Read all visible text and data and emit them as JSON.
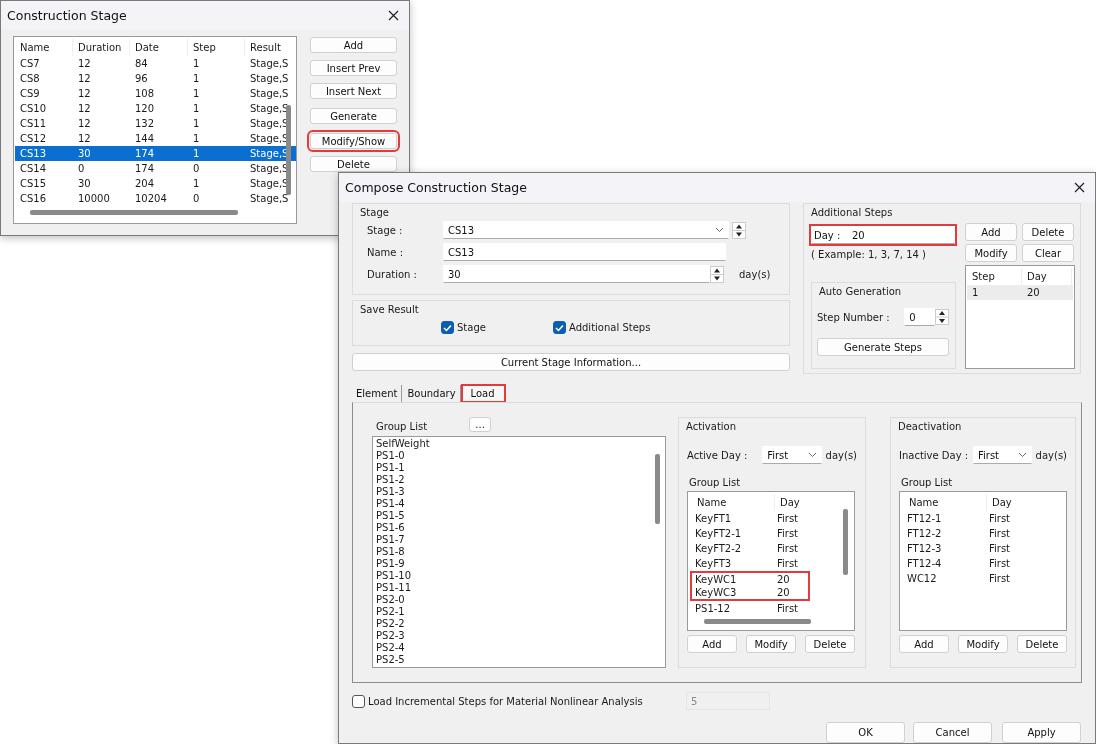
{
  "stage_list_window": {
    "title": "Construction Stage",
    "columns": [
      "Name",
      "Duration",
      "Date",
      "Step",
      "Result"
    ],
    "rows": [
      {
        "cells": [
          "CS7",
          "12",
          "84",
          "1",
          "Stage,S"
        ],
        "selected": false
      },
      {
        "cells": [
          "CS8",
          "12",
          "96",
          "1",
          "Stage,S"
        ],
        "selected": false
      },
      {
        "cells": [
          "CS9",
          "12",
          "108",
          "1",
          "Stage,S"
        ],
        "selected": false
      },
      {
        "cells": [
          "CS10",
          "12",
          "120",
          "1",
          "Stage,S"
        ],
        "selected": false
      },
      {
        "cells": [
          "CS11",
          "12",
          "132",
          "1",
          "Stage,S"
        ],
        "selected": false
      },
      {
        "cells": [
          "CS12",
          "12",
          "144",
          "1",
          "Stage,S"
        ],
        "selected": false
      },
      {
        "cells": [
          "CS13",
          "30",
          "174",
          "1",
          "Stage,S"
        ],
        "selected": true
      },
      {
        "cells": [
          "CS14",
          "0",
          "174",
          "0",
          "Stage,S"
        ],
        "selected": false
      },
      {
        "cells": [
          "CS15",
          "30",
          "204",
          "1",
          "Stage,S"
        ],
        "selected": false
      },
      {
        "cells": [
          "CS16",
          "10000",
          "10204",
          "0",
          "Stage,S"
        ],
        "selected": false
      }
    ],
    "buttons": [
      {
        "label": "Add",
        "highlighted": false
      },
      {
        "label": "Insert Prev",
        "highlighted": false
      },
      {
        "label": "Insert Next",
        "highlighted": false
      },
      {
        "label": "Generate",
        "highlighted": false
      },
      {
        "label": "Modify/Show",
        "highlighted": true
      },
      {
        "label": "Delete",
        "highlighted": false
      }
    ]
  },
  "compose_window": {
    "title": "Compose Construction Stage",
    "stage_group": {
      "title": "Stage",
      "stage_label": "Stage :",
      "stage_value": "CS13",
      "name_label": "Name :",
      "name_value": "CS13",
      "duration_label": "Duration :",
      "duration_value": "30",
      "unit": "day(s)"
    },
    "save_result": {
      "title": "Save Result",
      "options": [
        {
          "label": "Stage",
          "checked": true
        },
        {
          "label": "Additional Steps",
          "checked": true
        }
      ]
    },
    "info_button": "Current Stage Information...",
    "additional_steps": {
      "title": "Additional Steps",
      "day_label": "Day :",
      "day_value": "20",
      "day_highlighted": true,
      "example": "( Example: 1, 3, 7, 14  )",
      "buttons": [
        "Add",
        "Delete",
        "Modify",
        "Clear"
      ],
      "auto_generation": {
        "title": "Auto Generation",
        "step_label": "Step Number  :",
        "step_value": "0",
        "button": "Generate Steps"
      },
      "columns": [
        "Step",
        "Day"
      ],
      "rows": [
        {
          "cells": [
            "1",
            "20"
          ],
          "selected": true
        }
      ]
    },
    "tabs": [
      {
        "label": "Element",
        "selected": false,
        "highlighted": false
      },
      {
        "label": "Boundary",
        "selected": false,
        "highlighted": false
      },
      {
        "label": "Load",
        "selected": true,
        "highlighted": true
      }
    ],
    "group_list": {
      "label": "Group List",
      "browse_button": "...",
      "items": [
        "SelfWeight",
        "PS1-0",
        "PS1-1",
        "PS1-2",
        "PS1-3",
        "PS1-4",
        "PS1-5",
        "PS1-6",
        "PS1-7",
        "PS1-8",
        "PS1-9",
        "PS1-10",
        "PS1-11",
        "PS2-0",
        "PS2-1",
        "PS2-2",
        "PS2-3",
        "PS2-4",
        "PS2-5"
      ]
    },
    "activation": {
      "title": "Activation",
      "day_label": "Active Day :",
      "day_value": "First",
      "unit": "day(s)",
      "list_label": "Group List",
      "columns": [
        "Name",
        "Day"
      ],
      "rows": [
        {
          "cells": [
            "KeyFT1",
            "First"
          ],
          "highlighted": false
        },
        {
          "cells": [
            "KeyFT2-1",
            "First"
          ],
          "highlighted": false
        },
        {
          "cells": [
            "KeyFT2-2",
            "First"
          ],
          "highlighted": false
        },
        {
          "cells": [
            "KeyFT3",
            "First"
          ],
          "highlighted": false
        },
        {
          "cells": [
            "KeyWC1",
            "20"
          ],
          "highlighted": true
        },
        {
          "cells": [
            "KeyWC3",
            "20"
          ],
          "highlighted": true
        },
        {
          "cells": [
            "PS1-12",
            "First"
          ],
          "highlighted": false
        }
      ],
      "buttons": [
        "Add",
        "Modify",
        "Delete"
      ]
    },
    "deactivation": {
      "title": "Deactivation",
      "day_label": "Inactive Day :",
      "day_value": "First",
      "unit": "day(s)",
      "list_label": "Group List",
      "columns": [
        "Name",
        "Day"
      ],
      "rows": [
        {
          "cells": [
            "FT12-1",
            "First"
          ],
          "highlighted": false
        },
        {
          "cells": [
            "FT12-2",
            "First"
          ],
          "highlighted": false
        },
        {
          "cells": [
            "FT12-3",
            "First"
          ],
          "highlighted": false
        },
        {
          "cells": [
            "FT12-4",
            "First"
          ],
          "highlighted": false
        },
        {
          "cells": [
            "WC12",
            "First"
          ],
          "highlighted": false
        }
      ],
      "buttons": [
        "Add",
        "Modify",
        "Delete"
      ]
    },
    "incremental": {
      "label": "Load Incremental Steps for Material Nonlinear Analysis",
      "checked": false,
      "value": "5"
    },
    "footer_buttons": [
      "OK",
      "Cancel",
      "Apply"
    ]
  }
}
